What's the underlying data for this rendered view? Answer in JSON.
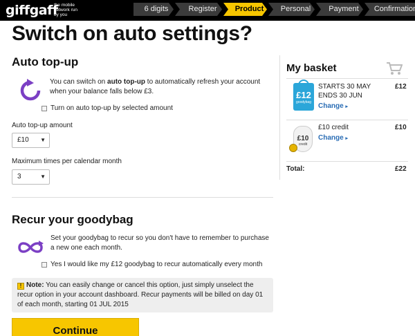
{
  "header": {
    "logo": "giffgaff",
    "tagline": "the mobile network run by you",
    "steps": [
      {
        "label": "6 digits",
        "active": false
      },
      {
        "label": "Register",
        "active": false
      },
      {
        "label": "Product",
        "active": true
      },
      {
        "label": "Personal",
        "active": false
      },
      {
        "label": "Payment",
        "active": false
      },
      {
        "label": "Confirmation",
        "active": false
      }
    ]
  },
  "page_title": "Switch on auto settings?",
  "auto_topup": {
    "heading": "Auto top-up",
    "desc_before": "You can switch on ",
    "desc_bold": "auto top-up",
    "desc_after": " to automatically refresh your account when your balance falls below £3.",
    "checkbox_label": "Turn on auto top-up by selected amount",
    "amount_label": "Auto top-up amount",
    "amount_value": "£10",
    "max_label": "Maximum times per calendar month",
    "max_value": "3"
  },
  "recur": {
    "heading": "Recur your goodybag",
    "desc": "Set your goodybag to recur so you don't have to remember to purchase a new one each month.",
    "checkbox_label": "Yes I would like my £12 goodybag to recur automatically every month"
  },
  "note": {
    "label": "Note:",
    "text": " You can easily change or cancel this option, just simply unselect the recur option in your account dashboard. Recur payments will be billed on day 01 of each month, starting 01 JUL 2015"
  },
  "continue_label": "Continue",
  "basket": {
    "title": "My basket",
    "items": [
      {
        "icon_text": "£12",
        "icon_sub": "goodybag",
        "line1": "STARTS 30 MAY",
        "line2": "ENDS 30 JUN",
        "change": "Change",
        "price": "£12"
      },
      {
        "icon_text": "£10",
        "icon_sub": "credit",
        "line1": "£10 credit",
        "change": "Change",
        "price": "£10"
      }
    ],
    "total_label": "Total:",
    "total_value": "£22"
  },
  "colors": {
    "accent": "#f7c600",
    "link": "#2a6db5",
    "icon_purple": "#7b3fc4",
    "goodybag_blue": "#2ba6d9"
  }
}
